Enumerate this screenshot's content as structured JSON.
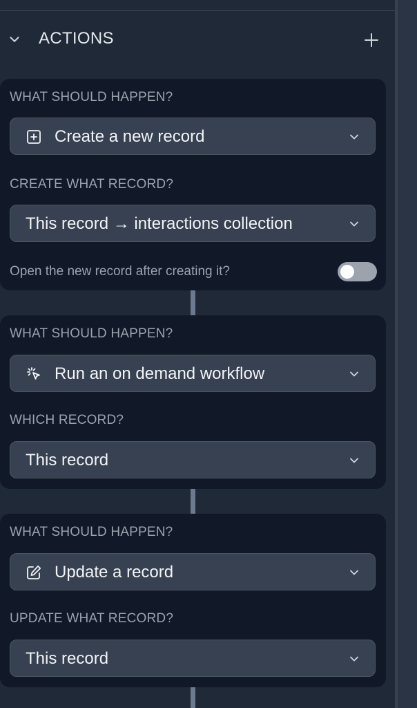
{
  "section": {
    "title": "ACTIONS",
    "collapse_icon": "chevron-down-icon",
    "add_icon": "plus-icon"
  },
  "actions": [
    {
      "label": "WHAT SHOULD HAPPEN?",
      "type_value": "Create a new record",
      "type_icon": "plus-square-icon",
      "sub_label": "CREATE WHAT RECORD?",
      "sub_value": "This record → interactions collection",
      "toggle_label": "Open the new record after creating it?",
      "toggle_on": false
    },
    {
      "label": "WHAT SHOULD HAPPEN?",
      "type_value": "Run an on demand workflow",
      "type_icon": "cursor-click-icon",
      "sub_label": "WHICH RECORD?",
      "sub_value": "This record"
    },
    {
      "label": "WHAT SHOULD HAPPEN?",
      "type_value": "Update a record",
      "type_icon": "pencil-square-icon",
      "sub_label": "UPDATE WHAT RECORD?",
      "sub_value": "This record"
    }
  ],
  "colors": {
    "panel_bg": "#1f2937",
    "card_bg": "#111827",
    "select_bg": "#374151",
    "label_text": "#9ca3af",
    "value_text": "#f3f4f6",
    "toggle_off": "#9ca3af",
    "connector": "#6b7a90"
  }
}
